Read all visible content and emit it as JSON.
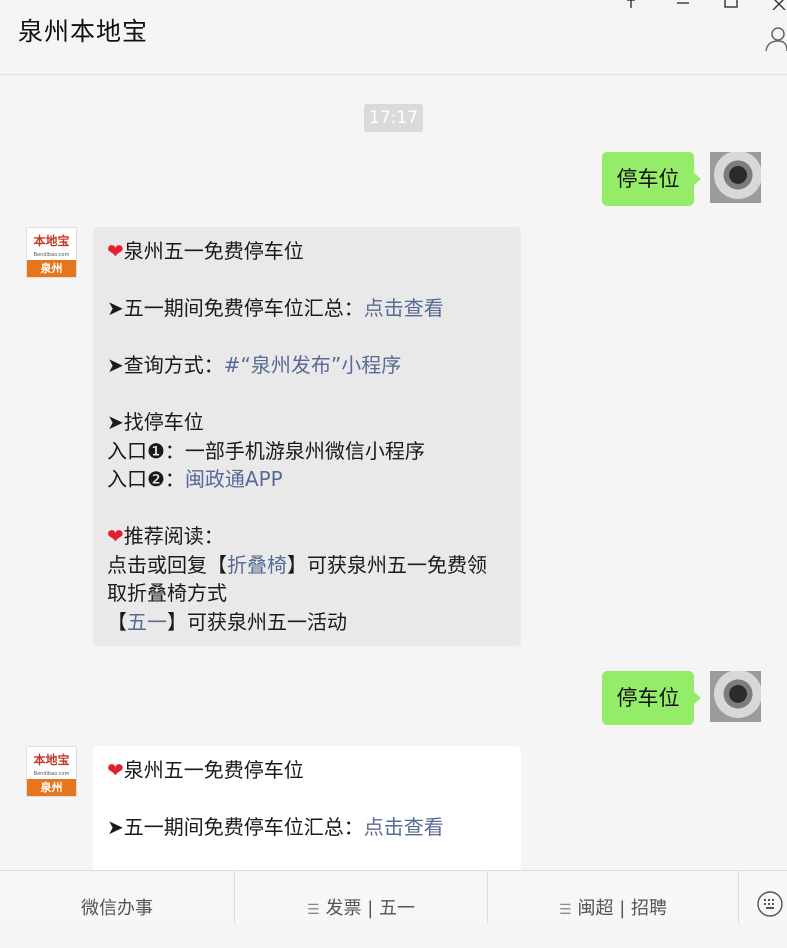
{
  "window": {
    "title": "泉州本地宝",
    "icons": [
      "pin-icon",
      "minimize-icon",
      "maximize-icon",
      "close-icon",
      "person-icon"
    ]
  },
  "chat": {
    "timestamp": "17:17",
    "messages": [
      {
        "from": "me",
        "text": "停车位"
      },
      {
        "from": "bot",
        "avatar": {
          "brand": "本地宝",
          "sub": "Bendibao.com",
          "city": "泉州"
        },
        "lines": [
          {
            "pre": "",
            "heart": true,
            "text": "泉州五一免费停车位",
            "link": ""
          },
          {
            "pre": "",
            "text": "",
            "link": ""
          },
          {
            "pre": "➤",
            "text": "五一期间免费停车位汇总：",
            "link": "点击查看"
          },
          {
            "pre": "",
            "text": "",
            "link": ""
          },
          {
            "pre": "➤",
            "text": "查询方式：",
            "link": "#“泉州发布”小程序"
          },
          {
            "pre": "",
            "text": "",
            "link": ""
          },
          {
            "pre": "➤",
            "text": "找停车位",
            "link": ""
          },
          {
            "pre": "",
            "text": "入口❶：一部手机游泉州微信小程序",
            "link": ""
          },
          {
            "pre": "",
            "text": "入口❷：",
            "link": "闽政通APP"
          },
          {
            "pre": "",
            "text": "",
            "link": ""
          },
          {
            "pre": "",
            "heart": true,
            "text": "推荐阅读：",
            "link": ""
          },
          {
            "pre": "",
            "text": "点击或回复【",
            "link": "折叠椅",
            "post": "】可获泉州五一免费领"
          },
          {
            "pre": "",
            "text": "取折叠椅方式",
            "link": ""
          },
          {
            "pre": "",
            "text": "【",
            "link": "五一",
            "post": "】可获泉州五一活动"
          }
        ]
      },
      {
        "from": "me",
        "text": "停车位"
      },
      {
        "from": "bot",
        "avatar": {
          "brand": "本地宝",
          "sub": "Bendibao.com",
          "city": "泉州"
        },
        "lines": [
          {
            "pre": "",
            "heart": true,
            "text": "泉州五一免费停车位",
            "link": ""
          },
          {
            "pre": "",
            "text": "",
            "link": ""
          },
          {
            "pre": "➤",
            "text": "五一期间免费停车位汇总：",
            "link": "点击查看"
          }
        ]
      }
    ]
  },
  "menu": {
    "items": [
      {
        "label": "微信办事",
        "has_icon": false
      },
      {
        "label": "发票 | 五一",
        "has_icon": true
      },
      {
        "label": "闽超 | 招聘",
        "has_icon": true
      }
    ],
    "keyboard_icon": "keyboard-icon"
  },
  "colors": {
    "my_bubble": "#95ec69",
    "link": "#576b95",
    "heart": "#e3212e",
    "bot_logo_orange": "#e8741c"
  }
}
